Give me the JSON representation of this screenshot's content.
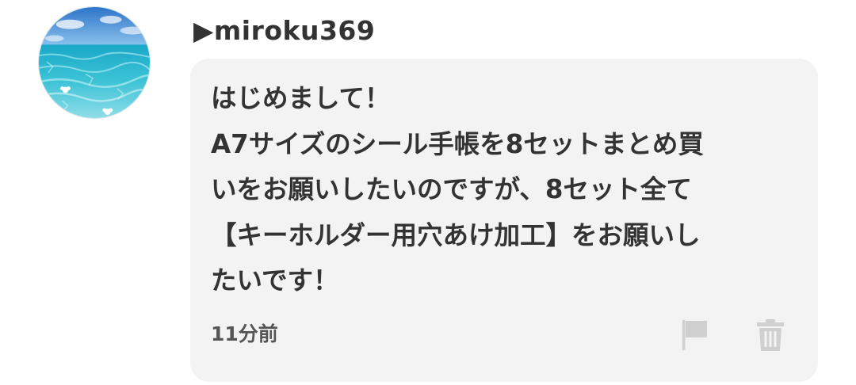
{
  "comment": {
    "avatar_icon": "ocean-avatar",
    "username": "▶miroku369",
    "message_lines": [
      "はじめまして！",
      "A7サイズのシール手帳を8セットまとめ買",
      "いをお願いしたいのですが、8セット全て",
      "【キーホルダー用穴あけ加工】をお願いし",
      "たいです！"
    ],
    "timestamp": "11分前",
    "actions": {
      "report_icon": "flag-icon",
      "delete_icon": "trash-icon"
    }
  },
  "colors": {
    "bubble_background": "#f3f3f3",
    "text": "#333333",
    "icon": "#d0d0d0"
  }
}
